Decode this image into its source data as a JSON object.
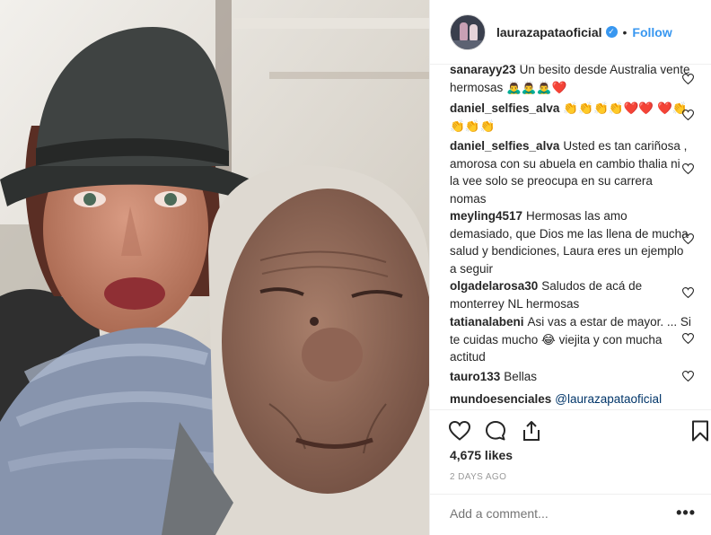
{
  "post": {
    "username": "laurazapataoficial",
    "verified": true,
    "separator": "•",
    "follow_label": "Follow",
    "likes": "4,675 likes",
    "time_ago": "2 DAYS AGO",
    "add_comment_placeholder": "Add a comment...",
    "more_label": "•••",
    "photo_alt": "Selfie of a woman in a grey hat with an elderly woman"
  },
  "comments": [
    {
      "user": "sanarayy23",
      "text": "Un besito desde Australia vente hermosas 🙇‍♂️🙇‍♂️🙇‍♂️❤️"
    },
    {
      "user": "daniel_selfies_alva",
      "text": "👏👏👏👏❤️❤️ ❤️👏👏👏👏"
    },
    {
      "user": "daniel_selfies_alva",
      "text": "Usted es tan cariñosa , amorosa con su abuela en cambio thalia ni la vee solo se preocupa en su carrera nomas"
    },
    {
      "user": "meyling4517",
      "text": "Hermosas las amo demasiado, que Dios me las llena de mucha salud y bendiciones, Laura eres un ejemplo a seguir"
    },
    {
      "user": "olgadelarosa30",
      "text": "Saludos de acá de monterrey NL hermosas"
    },
    {
      "user": "tatianalabeni",
      "text": "Asi vas a estar de mayor. ... Si te cuidas mucho 😂 viejita y con mucha actitud"
    },
    {
      "user": "tauro133",
      "text": "Bellas"
    },
    {
      "user": "mundoesenciales",
      "mention": "@laurazapataoficial"
    }
  ],
  "icons": {
    "verified": "verified-badge-icon",
    "like": "heart-outline-icon",
    "comment": "speech-bubble-icon",
    "share": "share-upload-icon",
    "save": "bookmark-icon",
    "comment_like": "small-heart-icon"
  },
  "colors": {
    "accent": "#3897f0",
    "text": "#262626",
    "muted": "#999999",
    "mention": "#003569"
  }
}
